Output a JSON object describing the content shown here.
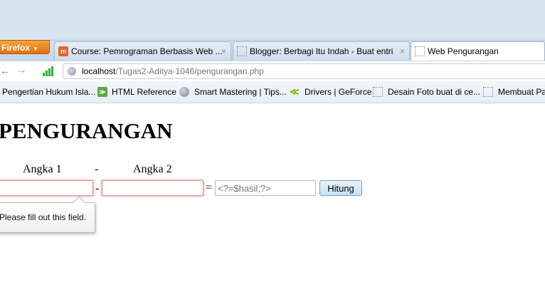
{
  "browser": {
    "app_button_label": "Firefox",
    "tabs": [
      {
        "label": "Course: Pemrograman Berbasis Web ...",
        "close": "×"
      },
      {
        "label": "Blogger: Berbagi Itu Indah - Buat entri",
        "close": "×"
      },
      {
        "label": "Web Pengurangan"
      }
    ],
    "url": {
      "host": "localhost",
      "path": "/Tugas2-Aditya-1046/pengurangan.php"
    },
    "bookmarks": [
      {
        "label": "Pengertian Hukum Isla..."
      },
      {
        "label": "HTML Reference"
      },
      {
        "label": "Smart Mastering | Tips..."
      },
      {
        "label": "Drivers | GeForce"
      },
      {
        "label": "Desain Foto buat di ce..."
      },
      {
        "label": "Membuat Pa"
      }
    ],
    "nav": {
      "back": "←",
      "forward": "→"
    }
  },
  "page": {
    "title": "PENGURANGAN",
    "labels": {
      "angka1": "Angka 1",
      "minus": "-",
      "angka2": "Angka 2"
    },
    "form": {
      "operator": "-",
      "equals": "=",
      "result_placeholder": "<?=$hasil;?>",
      "button_label": "Hitung"
    },
    "tooltip": "Please fill out this field."
  },
  "colors": {
    "firefox_orange": "#e0720d",
    "invalid_border": "#e28a8a",
    "button_blue": "#c7dff4"
  }
}
